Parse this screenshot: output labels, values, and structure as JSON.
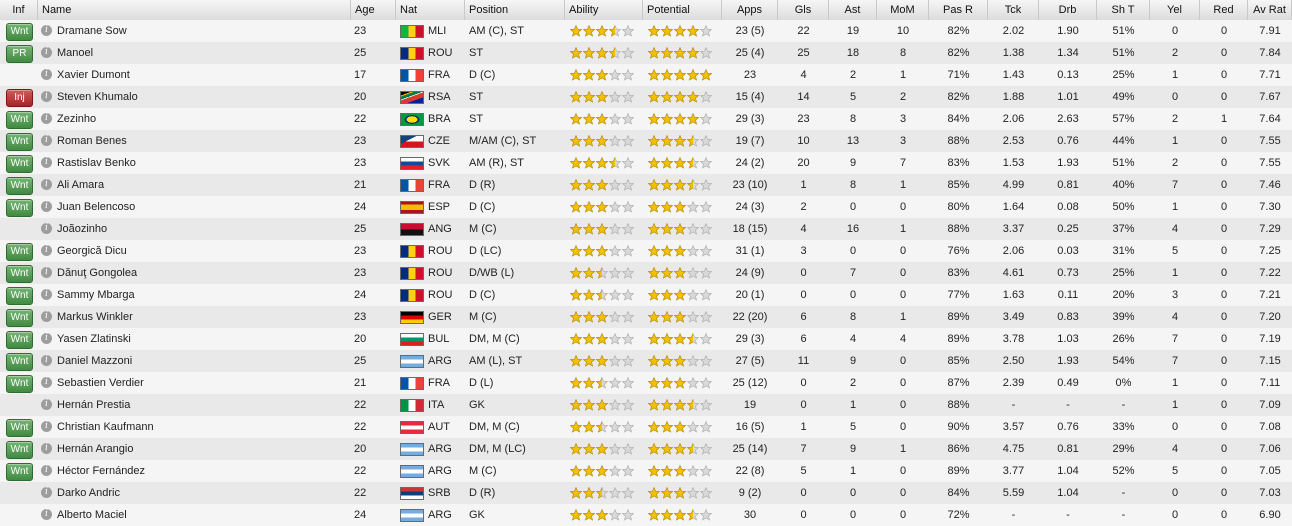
{
  "columns": [
    {
      "key": "inf",
      "label": "Inf"
    },
    {
      "key": "name",
      "label": "Name"
    },
    {
      "key": "age",
      "label": "Age"
    },
    {
      "key": "nat",
      "label": "Nat"
    },
    {
      "key": "position",
      "label": "Position"
    },
    {
      "key": "ability",
      "label": "Ability"
    },
    {
      "key": "potential",
      "label": "Potential"
    },
    {
      "key": "apps",
      "label": "Apps"
    },
    {
      "key": "gls",
      "label": "Gls"
    },
    {
      "key": "ast",
      "label": "Ast"
    },
    {
      "key": "mom",
      "label": "MoM"
    },
    {
      "key": "pasr",
      "label": "Pas R"
    },
    {
      "key": "tck",
      "label": "Tck"
    },
    {
      "key": "drb",
      "label": "Drb"
    },
    {
      "key": "sht",
      "label": "Sh T"
    },
    {
      "key": "yel",
      "label": "Yel"
    },
    {
      "key": "red",
      "label": "Red"
    },
    {
      "key": "avrat",
      "label": "Av Rat"
    }
  ],
  "status_colors": {
    "Wnt": "#418a41",
    "PR": "#418a41",
    "Inj": "#a52424"
  },
  "star_color": "#f2c200",
  "rows": [
    {
      "inf": "Wnt",
      "name": "Dramane Sow",
      "age": "23",
      "nat": "MLI",
      "flag": "mali",
      "position": "AM (C), ST",
      "ability": 3.5,
      "potential": 4,
      "apps": "23 (5)",
      "gls": "22",
      "ast": "19",
      "mom": "10",
      "pasr": "82%",
      "tck": "2.02",
      "drb": "1.90",
      "sht": "51%",
      "yel": "0",
      "red": "0",
      "avrat": "7.91"
    },
    {
      "inf": "PR",
      "name": "Manoel",
      "age": "25",
      "nat": "ROU",
      "flag": "romania",
      "position": "ST",
      "ability": 3.5,
      "potential": 4,
      "apps": "25 (4)",
      "gls": "25",
      "ast": "18",
      "mom": "8",
      "pasr": "82%",
      "tck": "1.38",
      "drb": "1.34",
      "sht": "51%",
      "yel": "2",
      "red": "0",
      "avrat": "7.84"
    },
    {
      "inf": "",
      "name": "Xavier Dumont",
      "age": "17",
      "nat": "FRA",
      "flag": "france",
      "position": "D (C)",
      "ability": 3,
      "potential": 5,
      "apps": "23",
      "gls": "4",
      "ast": "2",
      "mom": "1",
      "pasr": "71%",
      "tck": "1.43",
      "drb": "0.13",
      "sht": "25%",
      "yel": "1",
      "red": "0",
      "avrat": "7.71"
    },
    {
      "inf": "Inj",
      "name": "Steven Khumalo",
      "age": "20",
      "nat": "RSA",
      "flag": "rsa",
      "position": "ST",
      "ability": 3,
      "potential": 4,
      "apps": "15 (4)",
      "gls": "14",
      "ast": "5",
      "mom": "2",
      "pasr": "82%",
      "tck": "1.88",
      "drb": "1.01",
      "sht": "49%",
      "yel": "0",
      "red": "0",
      "avrat": "7.67"
    },
    {
      "inf": "Wnt",
      "name": "Zezinho",
      "age": "22",
      "nat": "BRA",
      "flag": "brazil",
      "position": "ST",
      "ability": 3,
      "potential": 4,
      "apps": "29 (3)",
      "gls": "23",
      "ast": "8",
      "mom": "3",
      "pasr": "84%",
      "tck": "2.06",
      "drb": "2.63",
      "sht": "57%",
      "yel": "2",
      "red": "1",
      "avrat": "7.64"
    },
    {
      "inf": "Wnt",
      "name": "Roman Benes",
      "age": "23",
      "nat": "CZE",
      "flag": "czech",
      "position": "M/AM (C), ST",
      "ability": 3,
      "potential": 3.5,
      "apps": "19 (7)",
      "gls": "10",
      "ast": "13",
      "mom": "3",
      "pasr": "88%",
      "tck": "2.53",
      "drb": "0.76",
      "sht": "44%",
      "yel": "1",
      "red": "0",
      "avrat": "7.55"
    },
    {
      "inf": "Wnt",
      "name": "Rastislav Benko",
      "age": "23",
      "nat": "SVK",
      "flag": "slovakia",
      "position": "AM (R), ST",
      "ability": 3.5,
      "potential": 3.5,
      "apps": "24 (2)",
      "gls": "20",
      "ast": "9",
      "mom": "7",
      "pasr": "83%",
      "tck": "1.53",
      "drb": "1.93",
      "sht": "51%",
      "yel": "2",
      "red": "0",
      "avrat": "7.55"
    },
    {
      "inf": "Wnt",
      "name": "Ali Amara",
      "age": "21",
      "nat": "FRA",
      "flag": "france",
      "position": "D (R)",
      "ability": 3,
      "potential": 3.5,
      "apps": "23 (10)",
      "gls": "1",
      "ast": "8",
      "mom": "1",
      "pasr": "85%",
      "tck": "4.99",
      "drb": "0.81",
      "sht": "40%",
      "yel": "7",
      "red": "0",
      "avrat": "7.46"
    },
    {
      "inf": "Wnt",
      "name": "Juan Belencoso",
      "age": "24",
      "nat": "ESP",
      "flag": "spain",
      "position": "D (C)",
      "ability": 3,
      "potential": 3,
      "apps": "24 (3)",
      "gls": "2",
      "ast": "0",
      "mom": "0",
      "pasr": "80%",
      "tck": "1.64",
      "drb": "0.08",
      "sht": "50%",
      "yel": "1",
      "red": "0",
      "avrat": "7.30"
    },
    {
      "inf": "",
      "name": "Joãozinho",
      "age": "25",
      "nat": "ANG",
      "flag": "angola",
      "position": "M (C)",
      "ability": 3,
      "potential": 3,
      "apps": "18 (15)",
      "gls": "4",
      "ast": "16",
      "mom": "1",
      "pasr": "88%",
      "tck": "3.37",
      "drb": "0.25",
      "sht": "37%",
      "yel": "4",
      "red": "0",
      "avrat": "7.29"
    },
    {
      "inf": "Wnt",
      "name": "Georgică Dicu",
      "age": "23",
      "nat": "ROU",
      "flag": "romania",
      "position": "D (LC)",
      "ability": 3,
      "potential": 3,
      "apps": "31 (1)",
      "gls": "3",
      "ast": "0",
      "mom": "0",
      "pasr": "76%",
      "tck": "2.06",
      "drb": "0.03",
      "sht": "31%",
      "yel": "5",
      "red": "0",
      "avrat": "7.25"
    },
    {
      "inf": "Wnt",
      "name": "Dănuţ Gongolea",
      "age": "23",
      "nat": "ROU",
      "flag": "romania",
      "position": "D/WB (L)",
      "ability": 2.5,
      "potential": 3,
      "apps": "24 (9)",
      "gls": "0",
      "ast": "7",
      "mom": "0",
      "pasr": "83%",
      "tck": "4.61",
      "drb": "0.73",
      "sht": "25%",
      "yel": "1",
      "red": "0",
      "avrat": "7.22"
    },
    {
      "inf": "Wnt",
      "name": "Sammy Mbarga",
      "age": "24",
      "nat": "ROU",
      "flag": "romania",
      "position": "D (C)",
      "ability": 2.5,
      "potential": 3,
      "apps": "20 (1)",
      "gls": "0",
      "ast": "0",
      "mom": "0",
      "pasr": "77%",
      "tck": "1.63",
      "drb": "0.11",
      "sht": "20%",
      "yel": "3",
      "red": "0",
      "avrat": "7.21"
    },
    {
      "inf": "Wnt",
      "name": "Markus Winkler",
      "age": "23",
      "nat": "GER",
      "flag": "germany",
      "position": "M (C)",
      "ability": 3,
      "potential": 3,
      "apps": "22 (20)",
      "gls": "6",
      "ast": "8",
      "mom": "1",
      "pasr": "89%",
      "tck": "3.49",
      "drb": "0.83",
      "sht": "39%",
      "yel": "4",
      "red": "0",
      "avrat": "7.20"
    },
    {
      "inf": "Wnt",
      "name": "Yasen Zlatinski",
      "age": "20",
      "nat": "BUL",
      "flag": "bulgaria",
      "position": "DM, M (C)",
      "ability": 3,
      "potential": 3.5,
      "apps": "29 (3)",
      "gls": "6",
      "ast": "4",
      "mom": "4",
      "pasr": "89%",
      "tck": "3.78",
      "drb": "1.03",
      "sht": "26%",
      "yel": "7",
      "red": "0",
      "avrat": "7.19"
    },
    {
      "inf": "Wnt",
      "name": "Daniel Mazzoni",
      "age": "25",
      "nat": "ARG",
      "flag": "argentina",
      "position": "AM (L), ST",
      "ability": 3,
      "potential": 3,
      "apps": "27 (5)",
      "gls": "11",
      "ast": "9",
      "mom": "0",
      "pasr": "85%",
      "tck": "2.50",
      "drb": "1.93",
      "sht": "54%",
      "yel": "7",
      "red": "0",
      "avrat": "7.15"
    },
    {
      "inf": "Wnt",
      "name": "Sebastien Verdier",
      "age": "21",
      "nat": "FRA",
      "flag": "france",
      "position": "D (L)",
      "ability": 2.5,
      "potential": 3,
      "apps": "25 (12)",
      "gls": "0",
      "ast": "2",
      "mom": "0",
      "pasr": "87%",
      "tck": "2.39",
      "drb": "0.49",
      "sht": "0%",
      "yel": "1",
      "red": "0",
      "avrat": "7.11"
    },
    {
      "inf": "",
      "name": "Hernán Prestia",
      "age": "22",
      "nat": "ITA",
      "flag": "italy",
      "position": "GK",
      "ability": 3,
      "potential": 3.5,
      "apps": "19",
      "gls": "0",
      "ast": "1",
      "mom": "0",
      "pasr": "88%",
      "tck": "-",
      "drb": "-",
      "sht": "-",
      "yel": "1",
      "red": "0",
      "avrat": "7.09"
    },
    {
      "inf": "Wnt",
      "name": "Christian Kaufmann",
      "age": "22",
      "nat": "AUT",
      "flag": "austria",
      "position": "DM, M (C)",
      "ability": 2.5,
      "potential": 3,
      "apps": "16 (5)",
      "gls": "1",
      "ast": "5",
      "mom": "0",
      "pasr": "90%",
      "tck": "3.57",
      "drb": "0.76",
      "sht": "33%",
      "yel": "0",
      "red": "0",
      "avrat": "7.08"
    },
    {
      "inf": "Wnt",
      "name": "Hernán Arangio",
      "age": "20",
      "nat": "ARG",
      "flag": "argentina",
      "position": "DM, M (LC)",
      "ability": 3,
      "potential": 3.5,
      "apps": "25 (14)",
      "gls": "7",
      "ast": "9",
      "mom": "1",
      "pasr": "86%",
      "tck": "4.75",
      "drb": "0.81",
      "sht": "29%",
      "yel": "4",
      "red": "0",
      "avrat": "7.06"
    },
    {
      "inf": "Wnt",
      "name": "Héctor Fernández",
      "age": "22",
      "nat": "ARG",
      "flag": "argentina",
      "position": "M (C)",
      "ability": 3,
      "potential": 3,
      "apps": "22 (8)",
      "gls": "5",
      "ast": "1",
      "mom": "0",
      "pasr": "89%",
      "tck": "3.77",
      "drb": "1.04",
      "sht": "52%",
      "yel": "5",
      "red": "0",
      "avrat": "7.05"
    },
    {
      "inf": "",
      "name": "Darko Andric",
      "age": "22",
      "nat": "SRB",
      "flag": "serbia",
      "position": "D (R)",
      "ability": 2.5,
      "potential": 3,
      "apps": "9 (2)",
      "gls": "0",
      "ast": "0",
      "mom": "0",
      "pasr": "84%",
      "tck": "5.59",
      "drb": "1.04",
      "sht": "-",
      "yel": "0",
      "red": "0",
      "avrat": "7.03"
    },
    {
      "inf": "",
      "name": "Alberto Maciel",
      "age": "24",
      "nat": "ARG",
      "flag": "argentina",
      "position": "GK",
      "ability": 3,
      "potential": 3.5,
      "apps": "30",
      "gls": "0",
      "ast": "0",
      "mom": "0",
      "pasr": "72%",
      "tck": "-",
      "drb": "-",
      "sht": "-",
      "yel": "0",
      "red": "0",
      "avrat": "6.90"
    }
  ]
}
